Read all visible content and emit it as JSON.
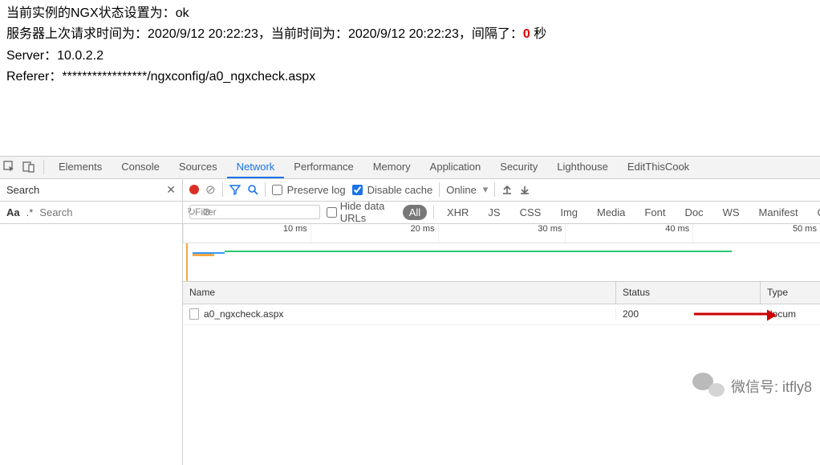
{
  "page": {
    "line1_prefix": "当前实例的NGX状态设置为：",
    "line1_value": "ok",
    "line2_a": "服务器上次请求时间为：",
    "line2_t1": "2020/9/12 20:22:23",
    "line2_b": "，当前时间为：",
    "line2_t2": "2020/9/12 20:22:23",
    "line2_c": "，间隔了：",
    "line2_interval": "0",
    "line2_unit": " 秒",
    "line3_label": "Server：",
    "line3_value": "10.0.2.2",
    "line4_label": "Referer：",
    "line4_value": "*****************/ngxconfig/a0_ngxcheck.aspx"
  },
  "devtools": {
    "tabs": [
      "Elements",
      "Console",
      "Sources",
      "Network",
      "Performance",
      "Memory",
      "Application",
      "Security",
      "Lighthouse",
      "EditThisCook"
    ],
    "active_tab": "Network",
    "search_label": "Search",
    "search_placeholder": "Search",
    "preserve_log": "Preserve log",
    "disable_cache": "Disable cache",
    "throttle": "Online",
    "filter_placeholder": "Filter",
    "hide_data_urls": "Hide data URLs",
    "filter_pills": [
      "All",
      "XHR",
      "JS",
      "CSS",
      "Img",
      "Media",
      "Font",
      "Doc",
      "WS",
      "Manifest",
      "O"
    ],
    "timeline_ticks": [
      "10 ms",
      "20 ms",
      "30 ms",
      "40 ms",
      "50 ms"
    ],
    "columns": {
      "name": "Name",
      "status": "Status",
      "type": "Type"
    },
    "rows": [
      {
        "name": "a0_ngxcheck.aspx",
        "status": "200",
        "type": "docum"
      }
    ]
  },
  "watermark": {
    "label": "微信号",
    "value": "itfly8"
  }
}
